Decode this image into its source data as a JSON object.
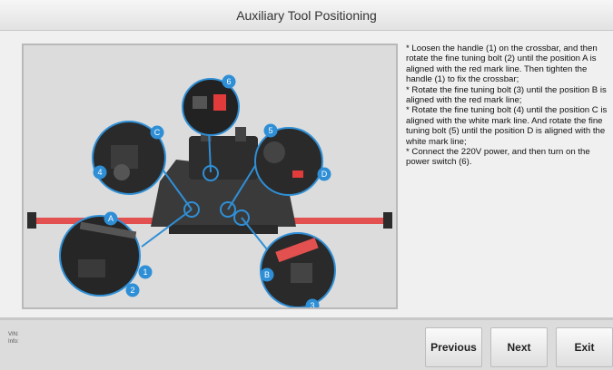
{
  "window": {
    "title": "Auxiliary Tool Positioning"
  },
  "instructions": {
    "text": "* Loosen the handle (1) on the crossbar, and then rotate the fine tuning bolt (2) until the position A is aligned with the red mark line. Then tighten the handle (1) to fix the crossbar;\n* Rotate the fine tuning bolt (3) until the position B is aligned with the red mark line;\n* Rotate the fine tuning bolt (4) until the position C is aligned with the white mark line. And rotate the fine tuning bolt (5) until the position D is aligned with the white mark line;\n* Connect the 220V power, and then turn on the power switch (6)."
  },
  "figure": {
    "callouts": {
      "n1": "1",
      "n2": "2",
      "n3": "3",
      "n4": "4",
      "n5": "5",
      "n6": "6",
      "A": "A",
      "B": "B",
      "C": "C",
      "D": "D"
    },
    "colors": {
      "badge": "#2f8fd6",
      "bar": "#e2504f",
      "machine": "#3a3a3a"
    }
  },
  "footer": {
    "vin_label": "VIN:",
    "info_label": "Info:",
    "previous_label": "Previous",
    "next_label": "Next",
    "exit_label": "Exit"
  }
}
